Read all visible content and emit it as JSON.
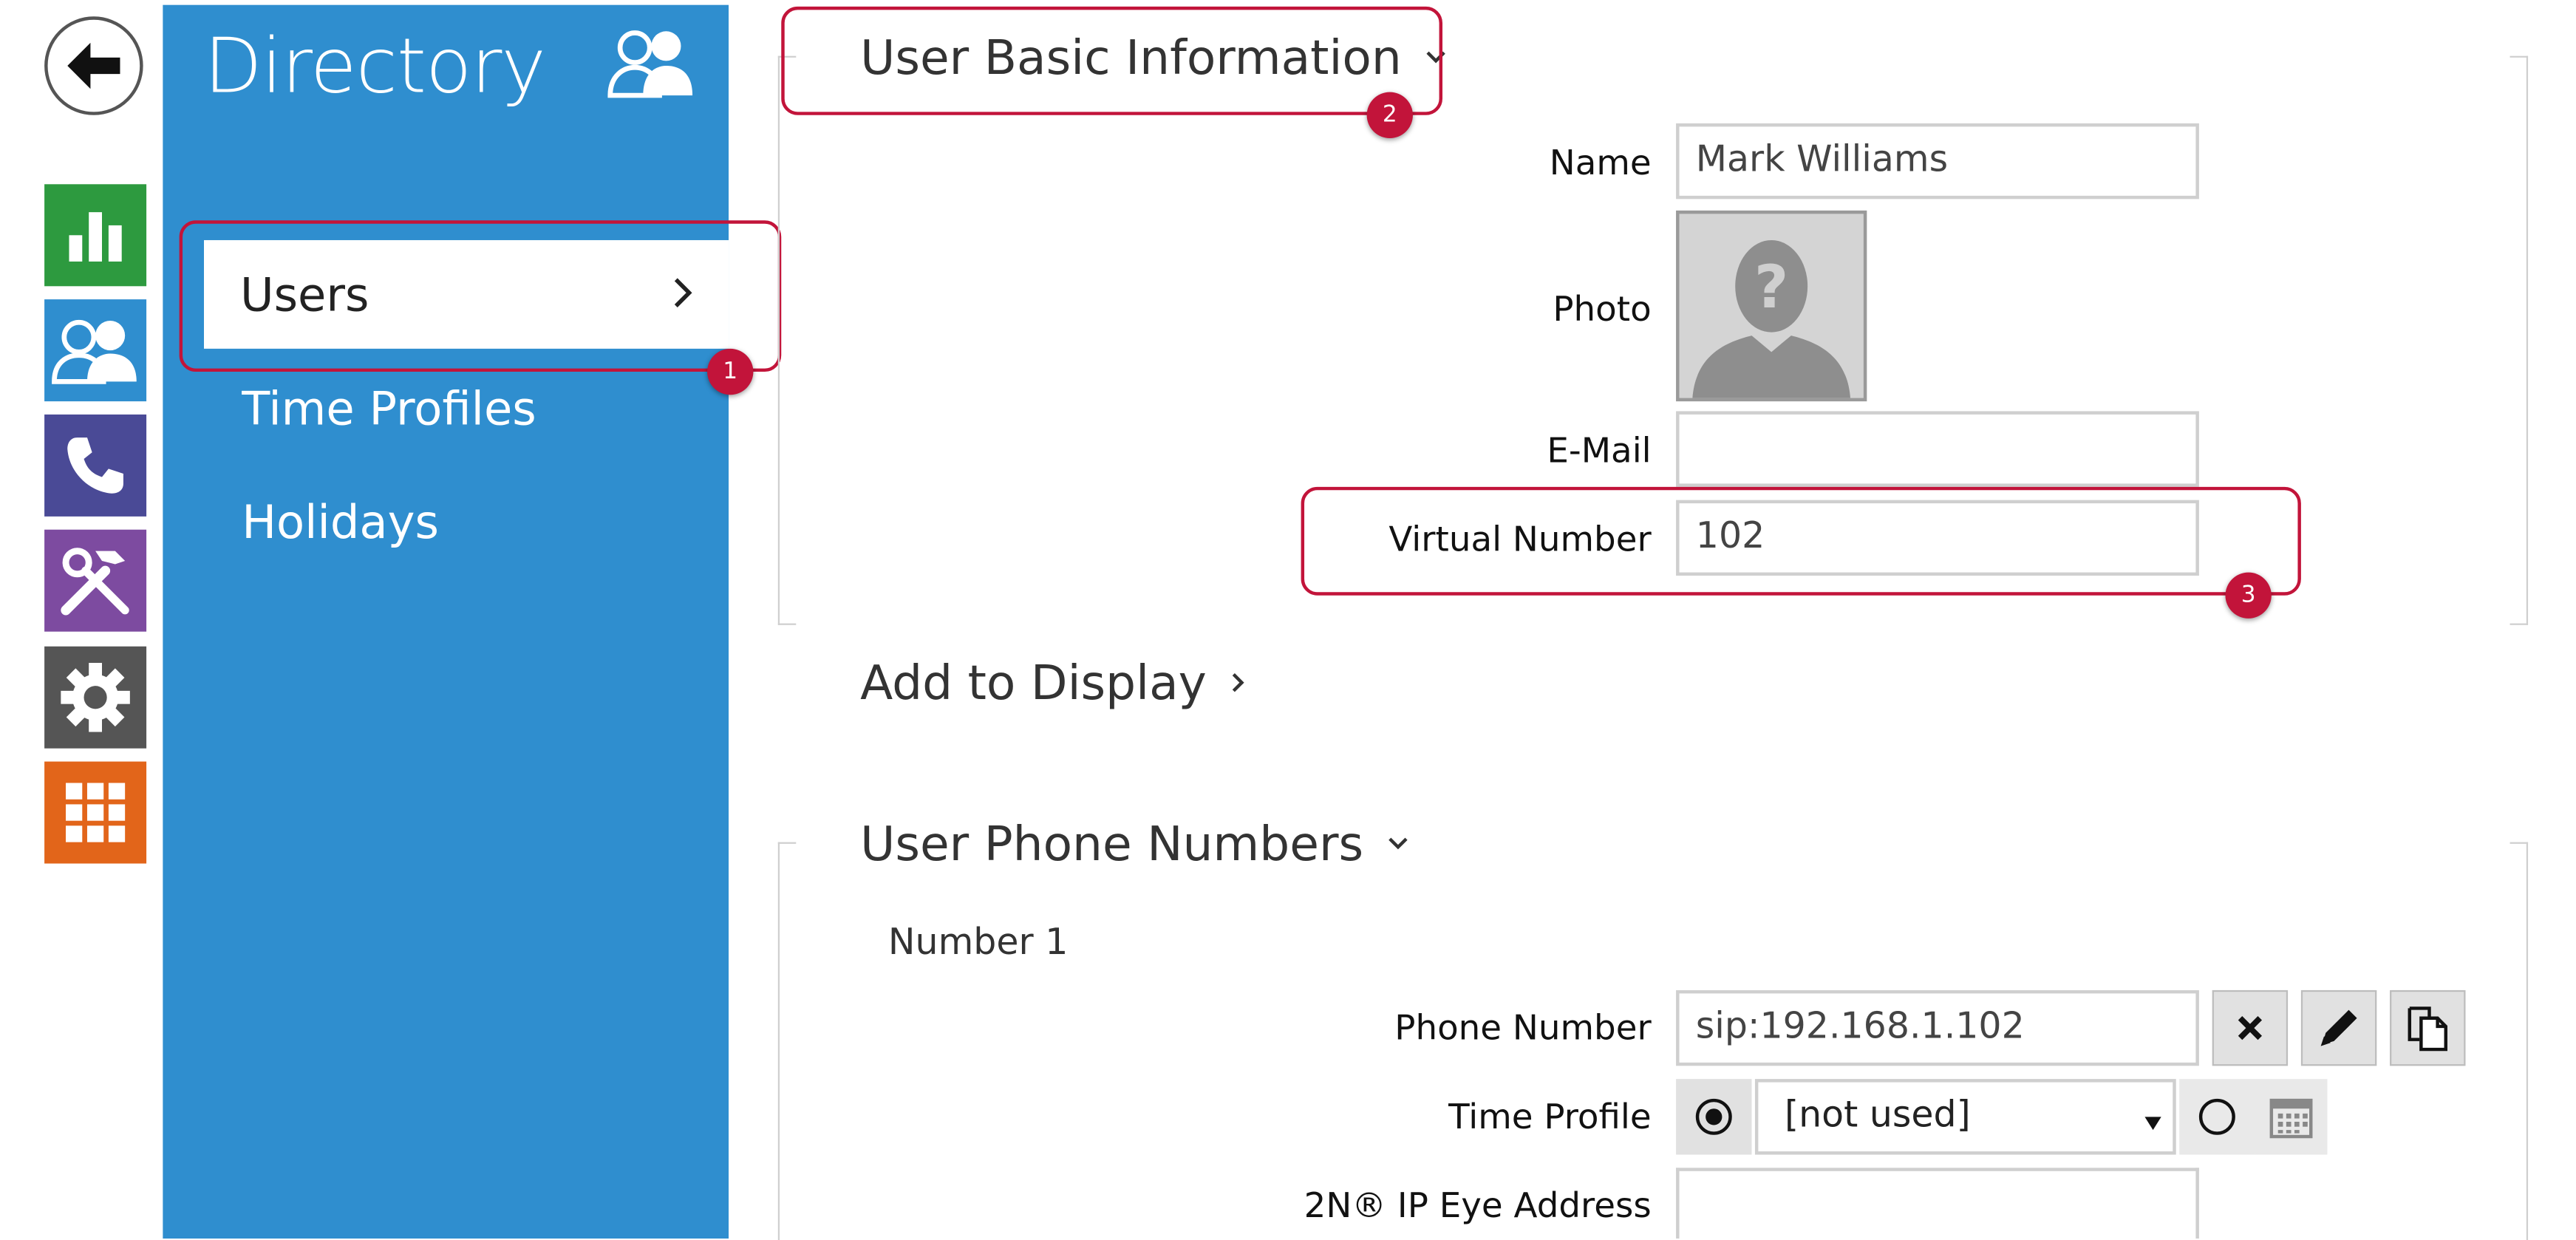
{
  "sidebar": {
    "title": "Directory",
    "nav": [
      {
        "label": "Users"
      },
      {
        "label": "Time Profiles"
      },
      {
        "label": "Holidays"
      }
    ],
    "rail_icons": [
      {
        "name": "status-icon",
        "color": "#2d9a3f"
      },
      {
        "name": "directory-icon",
        "color": "#2f8ecf"
      },
      {
        "name": "calls-icon",
        "color": "#4a4a96"
      },
      {
        "name": "hardware-icon",
        "color": "#7d4ba0"
      },
      {
        "name": "services-icon",
        "color": "#555555"
      },
      {
        "name": "system-icon",
        "color": "#e2651a"
      }
    ]
  },
  "callouts": {
    "one": "1",
    "two": "2",
    "three": "3"
  },
  "basic_info": {
    "title": "User Basic Information",
    "name_label": "Name",
    "name_value": "Mark Williams",
    "photo_label": "Photo",
    "email_label": "E-Mail",
    "email_value": "",
    "virtual_label": "Virtual Number",
    "virtual_value": "102"
  },
  "display": {
    "title": "Add to Display"
  },
  "phone_numbers": {
    "title": "User Phone Numbers",
    "number_heading": "Number 1",
    "phone_label": "Phone Number",
    "phone_value": "sip:192.168.1.102",
    "time_profile_label": "Time Profile",
    "time_profile_value": "[not used]",
    "ip_eye_label": "2N® IP Eye Address",
    "ip_eye_value": ""
  },
  "colors": {
    "accent": "#2f8ecf",
    "highlight": "#c2143a"
  }
}
